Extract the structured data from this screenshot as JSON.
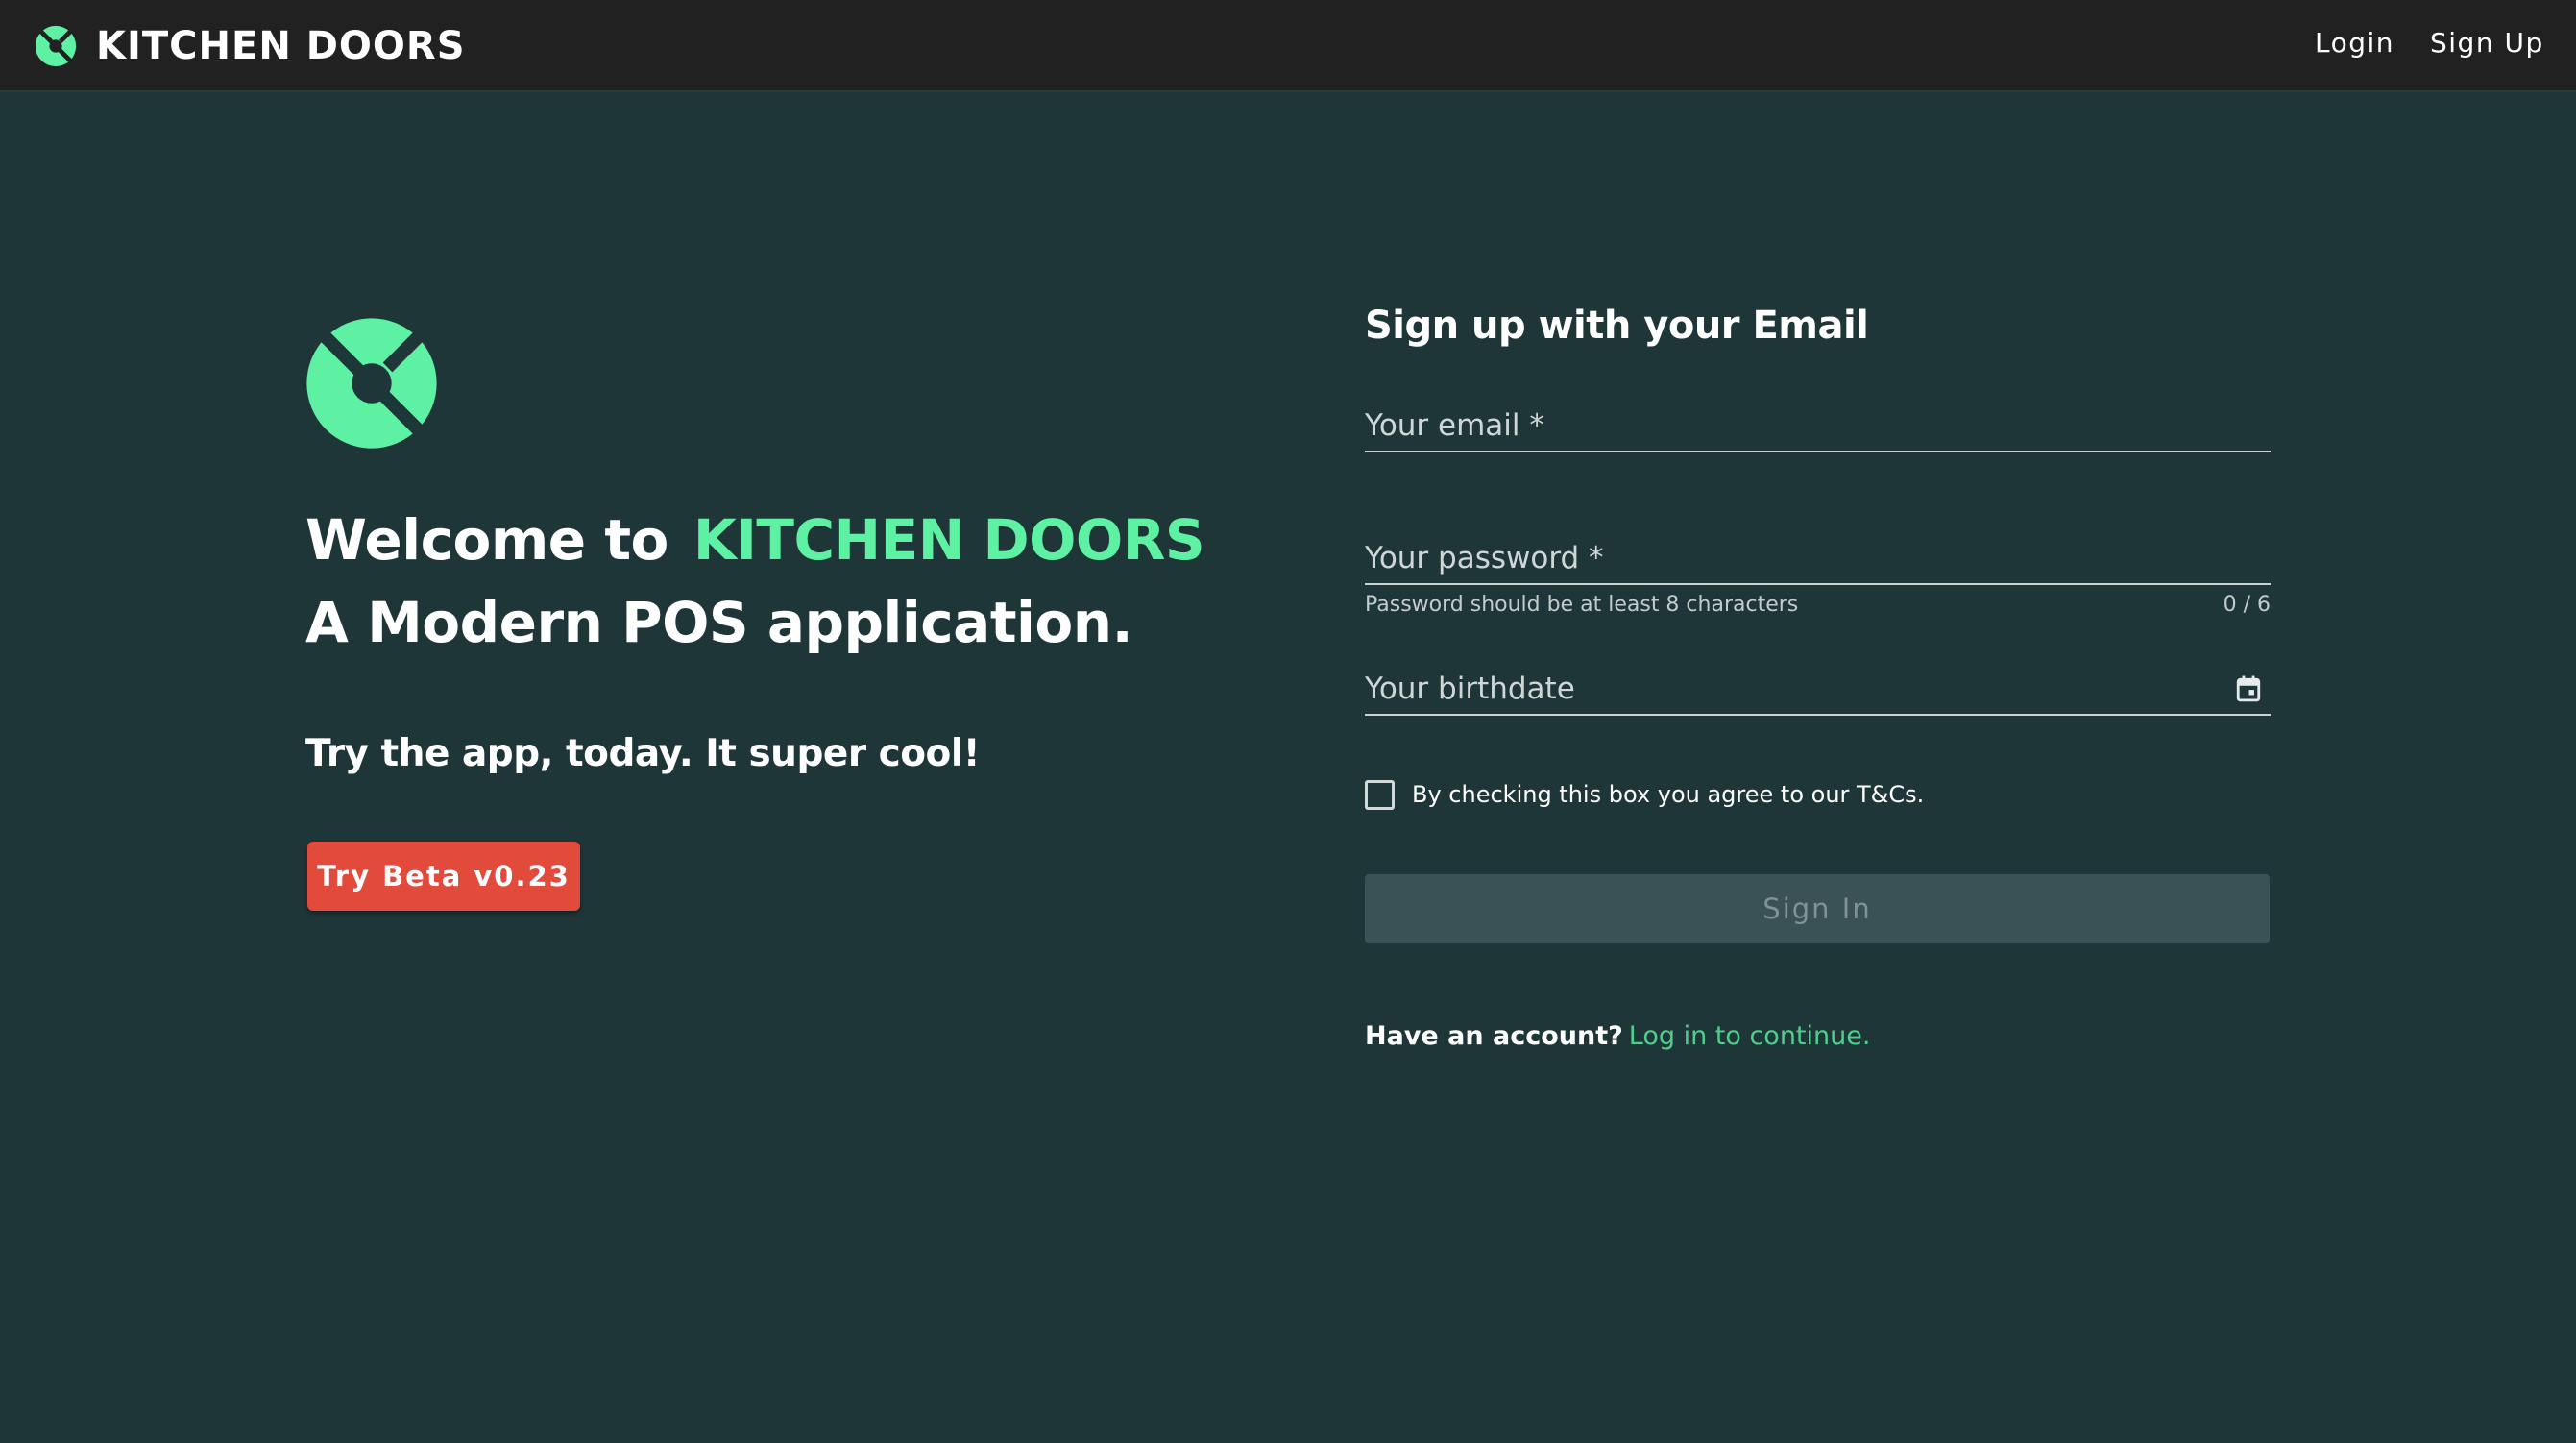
{
  "colors": {
    "background": "#1f3639",
    "topbar": "#212121",
    "brand_accent": "#5ef0a3",
    "beta_button": "#e24a3b",
    "signin_button_disabled": "#3a5155",
    "link": "#4fcf8c"
  },
  "header": {
    "brand_name": "KITCHEN DOORS",
    "logo_icon": "kitchen-doors-logo-icon",
    "nav": {
      "login": "Login",
      "signup": "Sign Up"
    }
  },
  "hero": {
    "logo_icon": "kitchen-doors-logo-icon",
    "welcome_prefix": "Welcome to",
    "brand_name": "KITCHEN DOORS",
    "subtitle": "A Modern POS application.",
    "tagline": "Try the app, today. It super cool!",
    "beta_button_label": "Try Beta v0.23"
  },
  "form": {
    "title": "Sign up with your Email",
    "email": {
      "placeholder": "Your email *",
      "value": ""
    },
    "password": {
      "placeholder": "Your password *",
      "value": "",
      "hint": "Password should be at least 8 characters",
      "counter": "0 / 6"
    },
    "birthdate": {
      "placeholder": "Your birthdate",
      "value": "",
      "icon": "calendar-icon"
    },
    "terms": {
      "label": "By checking this box you agree to our T&Cs.",
      "checked": false
    },
    "submit_label": "Sign In",
    "submit_disabled": true,
    "account_prompt": "Have an account?",
    "account_link": "Log in to continue."
  }
}
